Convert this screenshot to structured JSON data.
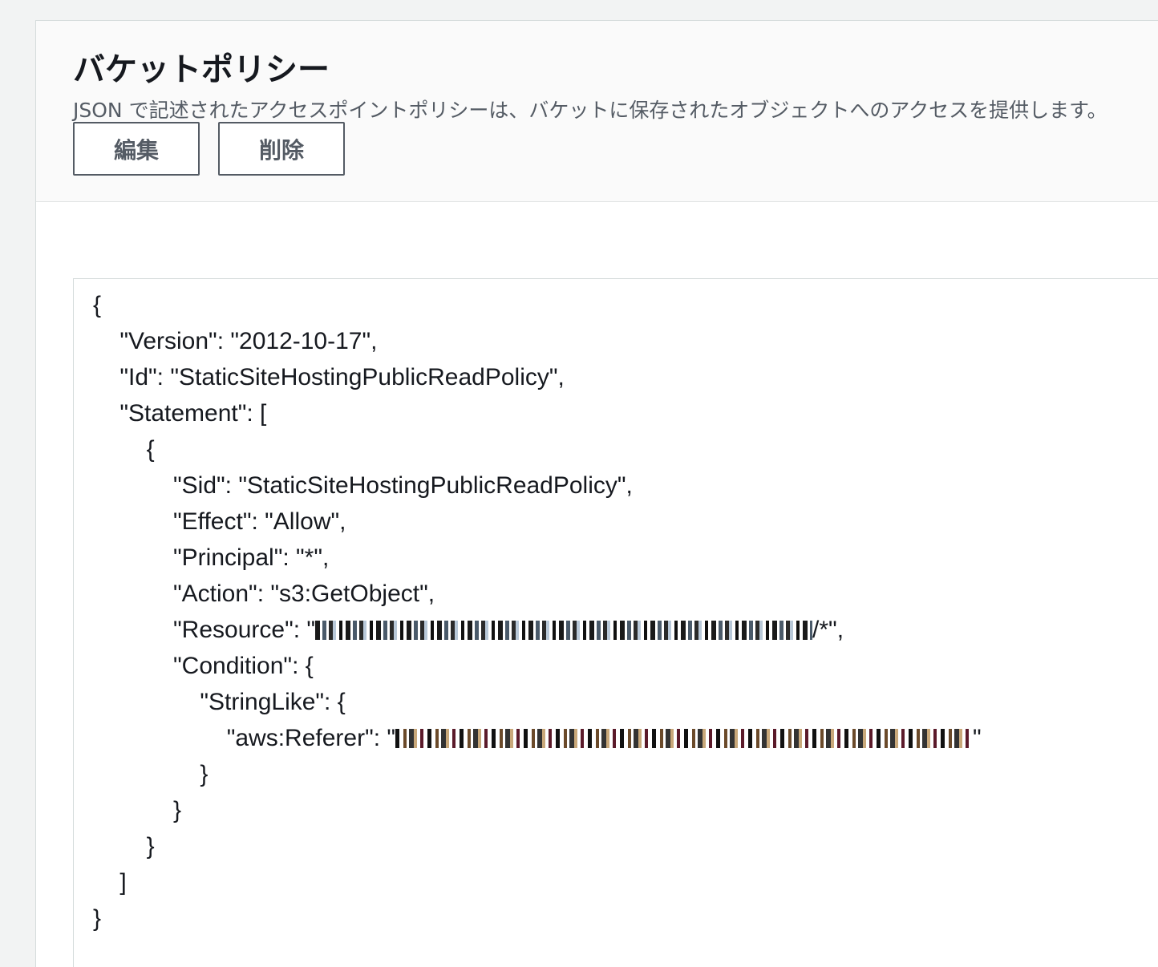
{
  "panel": {
    "title": "バケットポリシー",
    "description": "JSON で記述されたアクセスポイントポリシーは、バケットに保存されたオブジェクトへのアクセスを提供します。",
    "buttons": {
      "edit_label": "編集",
      "delete_label": "削除"
    }
  },
  "policy": {
    "lines": [
      "{",
      "    \"Version\": \"2012-10-17\",",
      "    \"Id\": \"StaticSiteHostingPublicReadPolicy\",",
      "    \"Statement\": [",
      "        {",
      "            \"Sid\": \"StaticSiteHostingPublicReadPolicy\",",
      "            \"Effect\": \"Allow\",",
      "            \"Principal\": \"*\",",
      "            \"Action\": \"s3:GetObject\","
    ],
    "resource_prefix": "            \"Resource\": \"",
    "resource_suffix": "/*\",",
    "condition_line": "            \"Condition\": {",
    "stringlike_line": "                \"StringLike\": {",
    "referer_prefix": "                    \"aws:Referer\": \"",
    "referer_suffix": "\"",
    "closing_lines": [
      "                }",
      "            }",
      "        }",
      "    ]",
      "}"
    ]
  },
  "icons": {
    "redacted_resource": "redacted-text",
    "redacted_referer": "redacted-text"
  }
}
